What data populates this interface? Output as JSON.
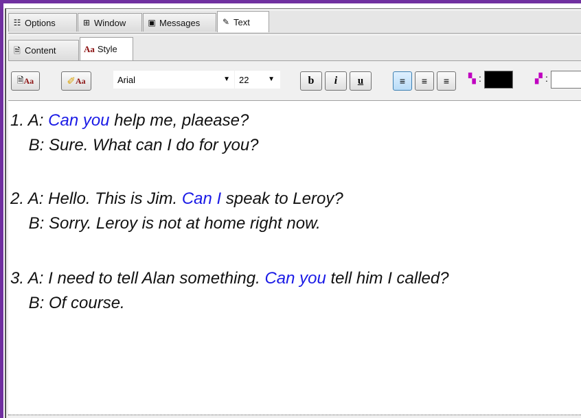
{
  "top_tabs": [
    {
      "label": "Options",
      "icon": "options-icon"
    },
    {
      "label": "Window",
      "icon": "window-icon"
    },
    {
      "label": "Messages",
      "icon": "messages-icon"
    },
    {
      "label": "Text",
      "icon": "edit-text-icon",
      "active": true
    }
  ],
  "sub_tabs": [
    {
      "label": "Content",
      "icon": "document-icon"
    },
    {
      "label": "Style",
      "icon_text": "Aa",
      "active": true
    }
  ],
  "toolbar": {
    "style_button_text": "Aa",
    "clear_style_button_text": "Aa",
    "font_family": "Arial",
    "font_size": "22",
    "bold": "b",
    "italic": "i",
    "underline": "u",
    "foreground_color": "#000000",
    "background_color": "#ffffff",
    "fg_color_label": ":",
    "bg_color_label": ":",
    "link_color": "#1a1ae6"
  },
  "content": {
    "dialogs": [
      {
        "line_a": [
          "1. A: ",
          "Can you",
          " help me, plaease?"
        ],
        "line_b": "    B: Sure. What can I do for you?"
      },
      {
        "line_a": [
          "2. A: Hello. This is Jim. ",
          "Can I",
          " speak to Leroy?"
        ],
        "line_b": "    B: Sorry. Leroy is not at home right now."
      },
      {
        "line_a": [
          "3. A: I need to tell Alan something. ",
          "Can you",
          " tell him I called?"
        ],
        "line_b": "    B: Of course."
      }
    ]
  }
}
